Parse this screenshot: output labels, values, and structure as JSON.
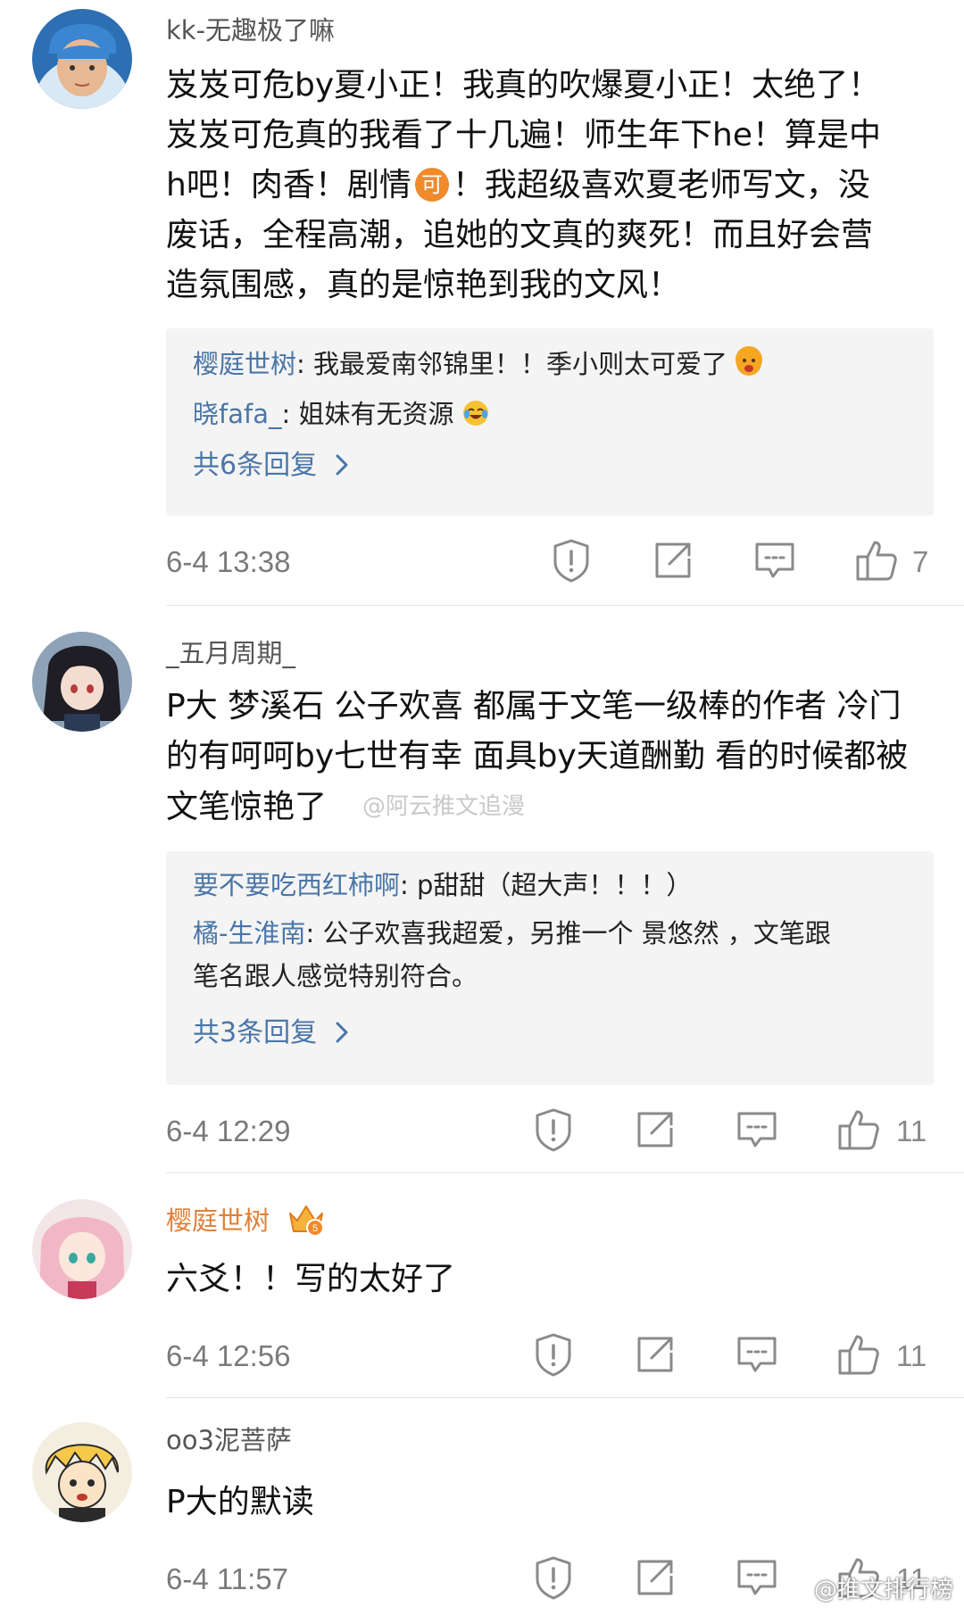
{
  "comments": [
    {
      "username": "kk-无趣极了嘛",
      "text_lines": [
        "岌岌可危by夏小正！我真的吹爆夏小正！太绝了！",
        "岌岌可危真的我看了十几遍！师生年下he！算是中",
        "h吧！肉香！剧情",
        "！我超级喜欢夏老师写文，没",
        "废话，全程高潮，追她的文真的爽死！而且好会营",
        "造氛围感，真的是惊艳到我的文风！"
      ],
      "badge": "可",
      "replies": [
        {
          "name": "樱庭世树",
          "text": ": 我最爱南邻锦里！！季小则太可爱了"
        },
        {
          "name": "晓fafa_",
          "text": ": 姐妹有无资源"
        }
      ],
      "more_replies": "共6条回复",
      "time": "6-4 13:38",
      "likes": "7"
    },
    {
      "username": "_五月周期_",
      "text_lines": [
        "P大 梦溪石 公子欢喜 都属于文笔一级棒的作者 冷门",
        "的有呵呵by七世有幸 面具by天道酬勤 看的时候都被",
        "文笔惊艳了"
      ],
      "watermark": "@阿云推文追漫",
      "replies": [
        {
          "name": "要不要吃西红柿啊",
          "text": ": p甜甜（超大声！！！）"
        },
        {
          "name": "橘-生淮南",
          "text": ": 公子欢喜我超爱，另推一个 景悠然 ，文笔跟",
          "text2": "笔名跟人感觉特别符合。"
        }
      ],
      "more_replies": "共3条回复",
      "time": "6-4 12:29",
      "likes": "11"
    },
    {
      "username": "樱庭世树",
      "text_lines": [
        "六爻！！写的太好了"
      ],
      "time": "6-4 12:56",
      "likes": "11"
    },
    {
      "username": "oo3泥菩萨",
      "text_lines": [
        "P大的默读"
      ],
      "time": "6-4 11:57",
      "likes": "11"
    }
  ],
  "bottom_watermark": "@推文排行榜",
  "icons": {
    "report": "report-icon",
    "share": "share-icon",
    "comment": "comment-icon",
    "like": "like-icon",
    "more_chevron": "chevron-right-icon"
  },
  "colors": {
    "link": "#4a76a8",
    "vip_name": "#e0803a",
    "badge": "#f08a2a"
  }
}
